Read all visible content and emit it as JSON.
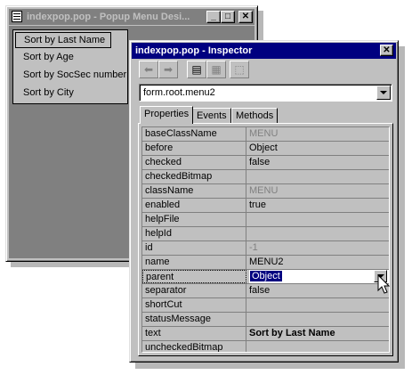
{
  "designer": {
    "title": "indexpop.pop - Popup Menu Desi...",
    "menu_items": [
      {
        "label": "Sort by Last Name"
      },
      {
        "label": "Sort by Age"
      },
      {
        "label": "Sort by SocSec number"
      },
      {
        "label": "Sort by City"
      }
    ],
    "controls": {
      "minimize": "_",
      "maximize": "□",
      "close": "✕"
    }
  },
  "inspector": {
    "title": "indexpop.pop - Inspector",
    "close_glyph": "✕",
    "object_selector": "form.root.menu2",
    "tabs": [
      {
        "label": "Properties"
      },
      {
        "label": "Events"
      },
      {
        "label": "Methods"
      }
    ],
    "toolbar_glyphs": {
      "back": "⬅",
      "forward": "➡",
      "categorize": "▤",
      "grid": "▦",
      "inherit": "⬚"
    },
    "properties": [
      {
        "name": "baseClassName",
        "value": "MENU"
      },
      {
        "name": "before",
        "value": "Object"
      },
      {
        "name": "checked",
        "value": "false"
      },
      {
        "name": "checkedBitmap",
        "value": ""
      },
      {
        "name": "className",
        "value": "MENU"
      },
      {
        "name": "enabled",
        "value": "true"
      },
      {
        "name": "helpFile",
        "value": ""
      },
      {
        "name": "helpId",
        "value": ""
      },
      {
        "name": "id",
        "value": "-1"
      },
      {
        "name": "name",
        "value": "MENU2"
      },
      {
        "name": "parent",
        "value": "Object"
      },
      {
        "name": "separator",
        "value": "false"
      },
      {
        "name": "shortCut",
        "value": ""
      },
      {
        "name": "statusMessage",
        "value": ""
      },
      {
        "name": "text",
        "value": "Sort by Last Name"
      },
      {
        "name": "uncheckedBitmap",
        "value": ""
      }
    ]
  },
  "colors": {
    "face": "#c0c0c0",
    "active_title": "#000080",
    "inactive_title": "#808080",
    "selection": "#000080"
  }
}
